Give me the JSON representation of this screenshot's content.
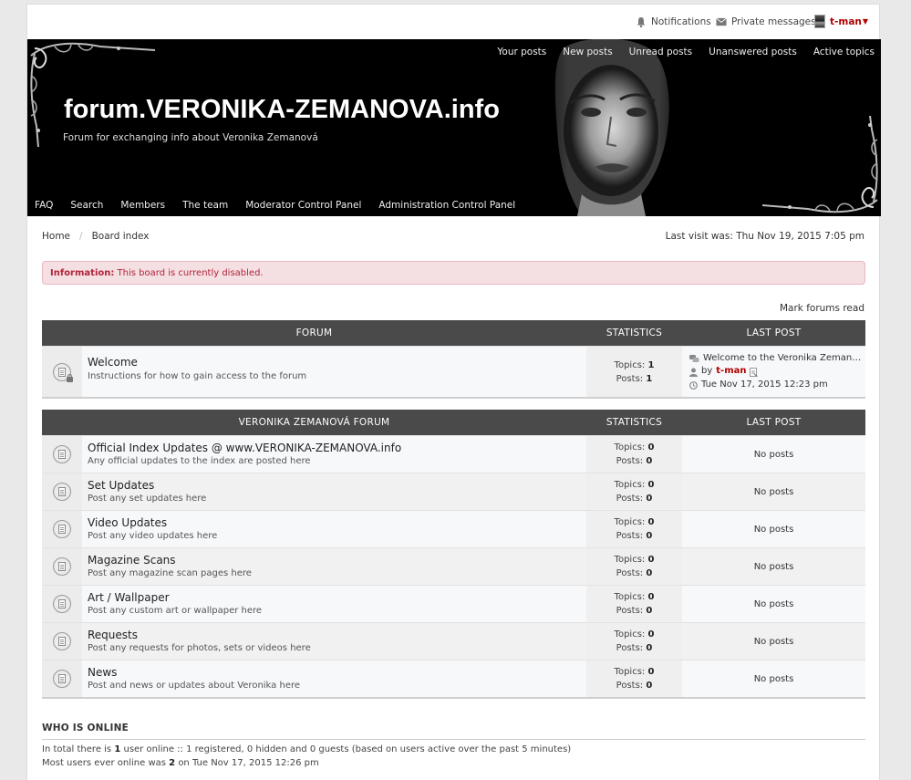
{
  "topbar": {
    "notifications": "Notifications",
    "private_messages": "Private messages",
    "username": "t-man"
  },
  "header": {
    "quick_links": [
      "Your posts",
      "New posts",
      "Unread posts",
      "Unanswered posts",
      "Active topics"
    ],
    "site_title": "forum.VERONIKA-ZEMANOVA.info",
    "site_description": "Forum for exchanging info about Veronika Zemanová",
    "nav": [
      "FAQ",
      "Search",
      "Members",
      "The team",
      "Moderator Control Panel",
      "Administration Control Panel"
    ]
  },
  "breadcrumb": {
    "home": "Home",
    "separator": "/",
    "board_index": "Board index"
  },
  "last_visit": "Last visit was: Thu Nov 19, 2015 7:05 pm",
  "information": {
    "label": "Information:",
    "message": "This board is currently disabled."
  },
  "mark_forums_read": "Mark forums read",
  "category1": {
    "headers": {
      "forum": "FORUM",
      "stats": "STATISTICS",
      "last": "LAST POST"
    },
    "forum": {
      "title": "Welcome",
      "description": "Instructions for how to gain access to the forum",
      "topics_label": "Topics:",
      "topics": "1",
      "posts_label": "Posts:",
      "posts": "1",
      "last_post_title": "Welcome to the Veronika Zeman…",
      "by": "by",
      "last_post_user": "t-man",
      "last_post_time": "Tue Nov 17, 2015 12:23 pm"
    }
  },
  "category2": {
    "headers": {
      "forum": "VERONIKA ZEMANOVÁ FORUM",
      "stats": "STATISTICS",
      "last": "LAST POST"
    },
    "forums": [
      {
        "title": "Official Index Updates @ www.VERONIKA-ZEMANOVA.info",
        "description": "Any official updates to the index are posted here",
        "topics_label": "Topics:",
        "topics": "0",
        "posts_label": "Posts:",
        "posts": "0",
        "last": "No posts"
      },
      {
        "title": "Set Updates",
        "description": "Post any set updates here",
        "topics_label": "Topics:",
        "topics": "0",
        "posts_label": "Posts:",
        "posts": "0",
        "last": "No posts"
      },
      {
        "title": "Video Updates",
        "description": "Post any video updates here",
        "topics_label": "Topics:",
        "topics": "0",
        "posts_label": "Posts:",
        "posts": "0",
        "last": "No posts"
      },
      {
        "title": "Magazine Scans",
        "description": "Post any magazine scan pages here",
        "topics_label": "Topics:",
        "topics": "0",
        "posts_label": "Posts:",
        "posts": "0",
        "last": "No posts"
      },
      {
        "title": "Art / Wallpaper",
        "description": "Post any custom art or wallpaper here",
        "topics_label": "Topics:",
        "topics": "0",
        "posts_label": "Posts:",
        "posts": "0",
        "last": "No posts"
      },
      {
        "title": "Requests",
        "description": "Post any requests for photos, sets or videos here",
        "topics_label": "Topics:",
        "topics": "0",
        "posts_label": "Posts:",
        "posts": "0",
        "last": "No posts"
      },
      {
        "title": "News",
        "description": "Post and news or updates about Veronika here",
        "topics_label": "Topics:",
        "topics": "0",
        "posts_label": "Posts:",
        "posts": "0",
        "last": "No posts"
      }
    ]
  },
  "who_is_online": {
    "title": "WHO IS ONLINE",
    "line1_prefix": "In total there is",
    "line1_count": "1",
    "line1_suffix": "user online :: 1 registered, 0 hidden and 0 guests (based on users active over the past 5 minutes)",
    "line2_prefix": "Most users ever online was",
    "line2_count": "2",
    "line2_suffix": "on Tue Nov 17, 2015 12:26 pm"
  },
  "colors": {
    "header_bg": "#000000",
    "table_header_bg": "#4a4a4a",
    "username": "#b00000",
    "info_text": "#b2233a",
    "info_bg": "#f4dfe2"
  }
}
